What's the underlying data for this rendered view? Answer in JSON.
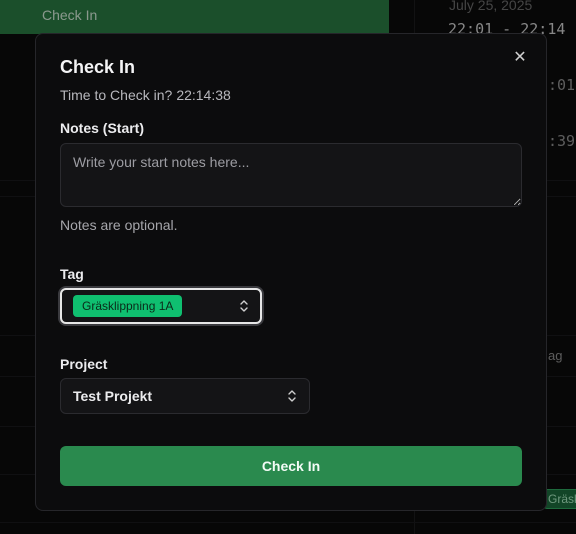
{
  "background": {
    "checkin_label": "Check In",
    "date": "July 25, 2025",
    "time_range": "22:01 - 22:14",
    "time_fragment_1": ":01",
    "time_fragment_2": ":39",
    "tag_fragment": "ag",
    "badge_fragment": "Gräsk"
  },
  "modal": {
    "title": "Check In",
    "subtitle_prefix": "Time to Check in?",
    "subtitle_time": "22:14:38",
    "notes_label": "Notes (Start)",
    "notes_value": "",
    "notes_placeholder": "Write your start notes here...",
    "notes_hint": "Notes are optional.",
    "tag_label": "Tag",
    "tag_selected": "Gräsklippning 1A",
    "project_label": "Project",
    "project_selected": "Test Projekt",
    "submit_label": "Check In",
    "close_glyph": "✕"
  },
  "colors": {
    "accent": "#2a8a4e",
    "tag_chip": "#0fbf70"
  }
}
